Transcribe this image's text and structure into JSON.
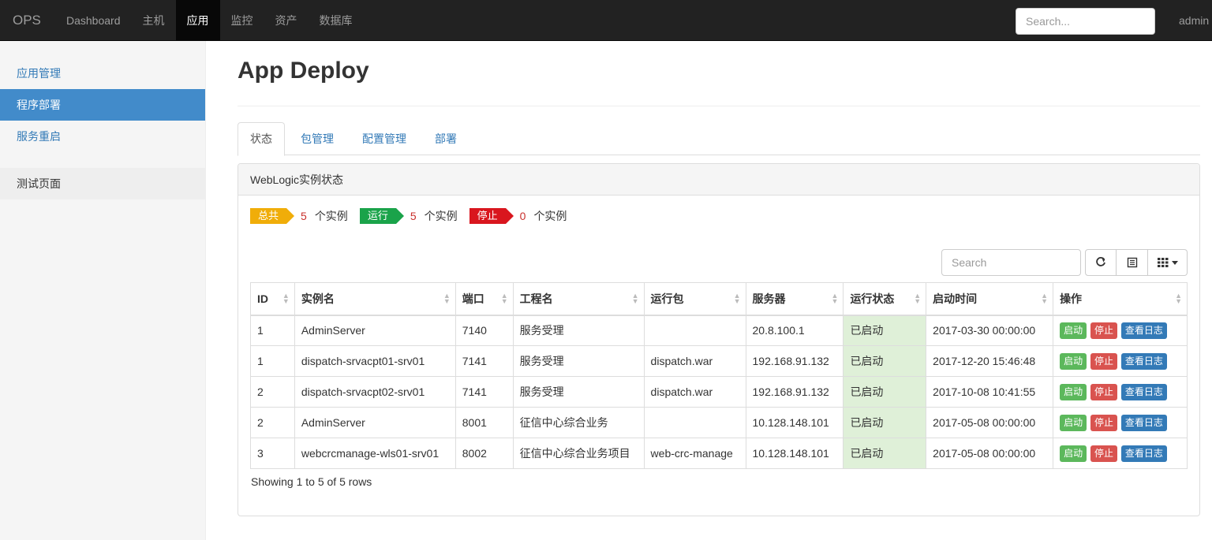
{
  "navbar": {
    "brand": "OPS",
    "items": [
      {
        "label": "Dashboard"
      },
      {
        "label": "主机"
      },
      {
        "label": "应用"
      },
      {
        "label": "监控"
      },
      {
        "label": "资产"
      },
      {
        "label": "数据库"
      }
    ],
    "active_index": 2,
    "search_placeholder": "Search...",
    "user": "admin"
  },
  "sidebar": {
    "items": [
      {
        "label": "应用管理"
      },
      {
        "label": "程序部署"
      },
      {
        "label": "服务重启"
      }
    ],
    "active_index": 1,
    "extra_item": "测试页面"
  },
  "main": {
    "title": "App Deploy",
    "tabs": [
      {
        "label": "状态"
      },
      {
        "label": "包管理"
      },
      {
        "label": "配置管理"
      },
      {
        "label": "部署"
      }
    ],
    "active_tab": 0,
    "panel_title": "WebLogic实例状态",
    "summary": {
      "total_label": "总共",
      "total_count": "5",
      "running_label": "运行",
      "running_count": "5",
      "stopped_label": "停止",
      "stopped_count": "0",
      "unit": "个实例"
    },
    "table_search_placeholder": "Search",
    "columns": [
      "ID",
      "实例名",
      "端口",
      "工程名",
      "运行包",
      "服务器",
      "运行状态",
      "启动时间",
      "操作"
    ],
    "rows": [
      {
        "id": "1",
        "instance": "AdminServer",
        "port": "7140",
        "project": "服务受理",
        "package": "",
        "server": "20.8.100.1",
        "status": "已启动",
        "start_time": "2017-03-30 00:00:00"
      },
      {
        "id": "1",
        "instance": "dispatch-srvacpt01-srv01",
        "port": "7141",
        "project": "服务受理",
        "package": "dispatch.war",
        "server": "192.168.91.132",
        "status": "已启动",
        "start_time": "2017-12-20 15:46:48"
      },
      {
        "id": "2",
        "instance": "dispatch-srvacpt02-srv01",
        "port": "7141",
        "project": "服务受理",
        "package": "dispatch.war",
        "server": "192.168.91.132",
        "status": "已启动",
        "start_time": "2017-10-08 10:41:55"
      },
      {
        "id": "2",
        "instance": "AdminServer",
        "port": "8001",
        "project": "征信中心综合业务",
        "package": "",
        "server": "10.128.148.101",
        "status": "已启动",
        "start_time": "2017-05-08 00:00:00"
      },
      {
        "id": "3",
        "instance": "webcrcmanage-wls01-srv01",
        "port": "8002",
        "project": "征信中心综合业务项目",
        "package": "web-crc-manage",
        "server": "10.128.148.101",
        "status": "已启动",
        "start_time": "2017-05-08 00:00:00"
      }
    ],
    "actions": {
      "start": "启动",
      "stop": "停止",
      "logs": "查看日志"
    },
    "pagination_info": "Showing 1 to 5 of 5 rows"
  }
}
